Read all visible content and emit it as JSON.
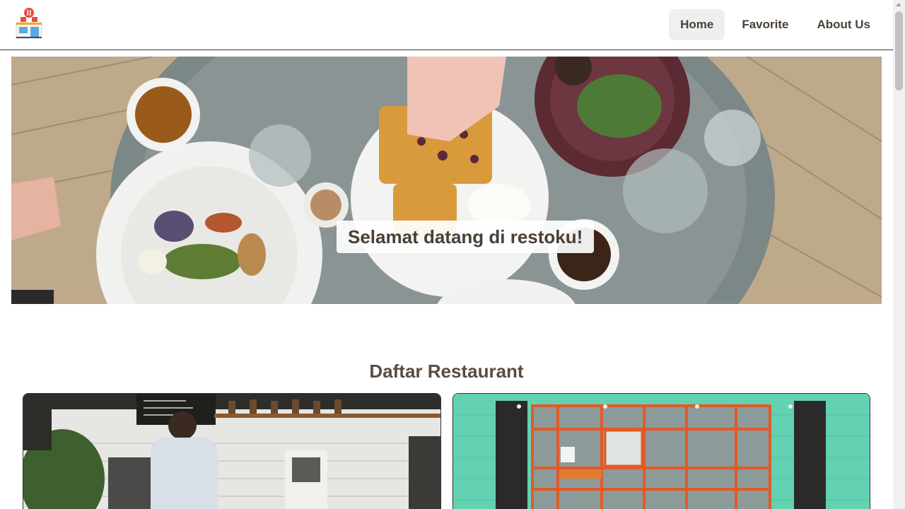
{
  "header": {
    "logo_icon": "restaurant-store-icon",
    "nav": [
      {
        "label": "Home",
        "active": true
      },
      {
        "label": "Favorite",
        "active": false
      },
      {
        "label": "About Us",
        "active": false
      }
    ]
  },
  "hero": {
    "caption": "Selamat datang di restoku!"
  },
  "section": {
    "title": "Daftar Restaurant"
  },
  "colors": {
    "text": "#4a4037",
    "nav_active_bg": "#efefef",
    "header_border": "#3a3a3a"
  }
}
